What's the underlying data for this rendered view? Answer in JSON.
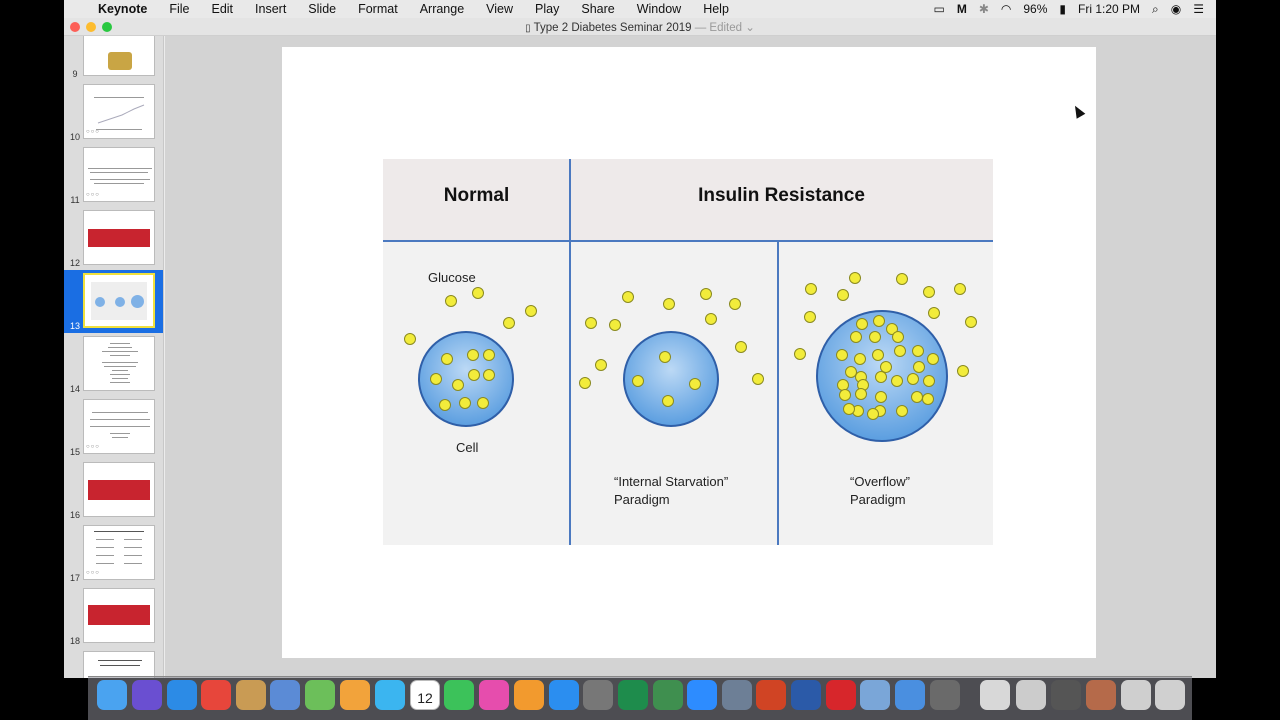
{
  "menubar": {
    "app": "Keynote",
    "items": [
      "File",
      "Edit",
      "Insert",
      "Slide",
      "Format",
      "Arrange",
      "View",
      "Play",
      "Share",
      "Window",
      "Help"
    ],
    "battery": "96%",
    "clock": "Fri 1:20 PM"
  },
  "window": {
    "title": "Type 2 Diabetes Seminar 2019",
    "edited": "— Edited"
  },
  "navigator": {
    "slides": [
      {
        "num": "9"
      },
      {
        "num": "10"
      },
      {
        "num": "11"
      },
      {
        "num": "12"
      },
      {
        "num": "13"
      },
      {
        "num": "14"
      },
      {
        "num": "15"
      },
      {
        "num": "16"
      },
      {
        "num": "17"
      },
      {
        "num": "18"
      }
    ],
    "selected": "13"
  },
  "slide": {
    "header_normal": "Normal",
    "header_ir": "Insulin Resistance",
    "label_glucose": "Glucose",
    "label_cell": "Cell",
    "label_internal_1": "“Internal Starvation”",
    "label_internal_2": "Paradigm",
    "label_overflow_1": "“Overflow”",
    "label_overflow_2": "Paradigm"
  },
  "colors": {
    "glucose": "#f2ec3b",
    "cell": "#5b9ee0",
    "grid_line": "#4b79c0",
    "selection": "#1a6ee3"
  },
  "dock": {
    "calendar_day": "12"
  }
}
